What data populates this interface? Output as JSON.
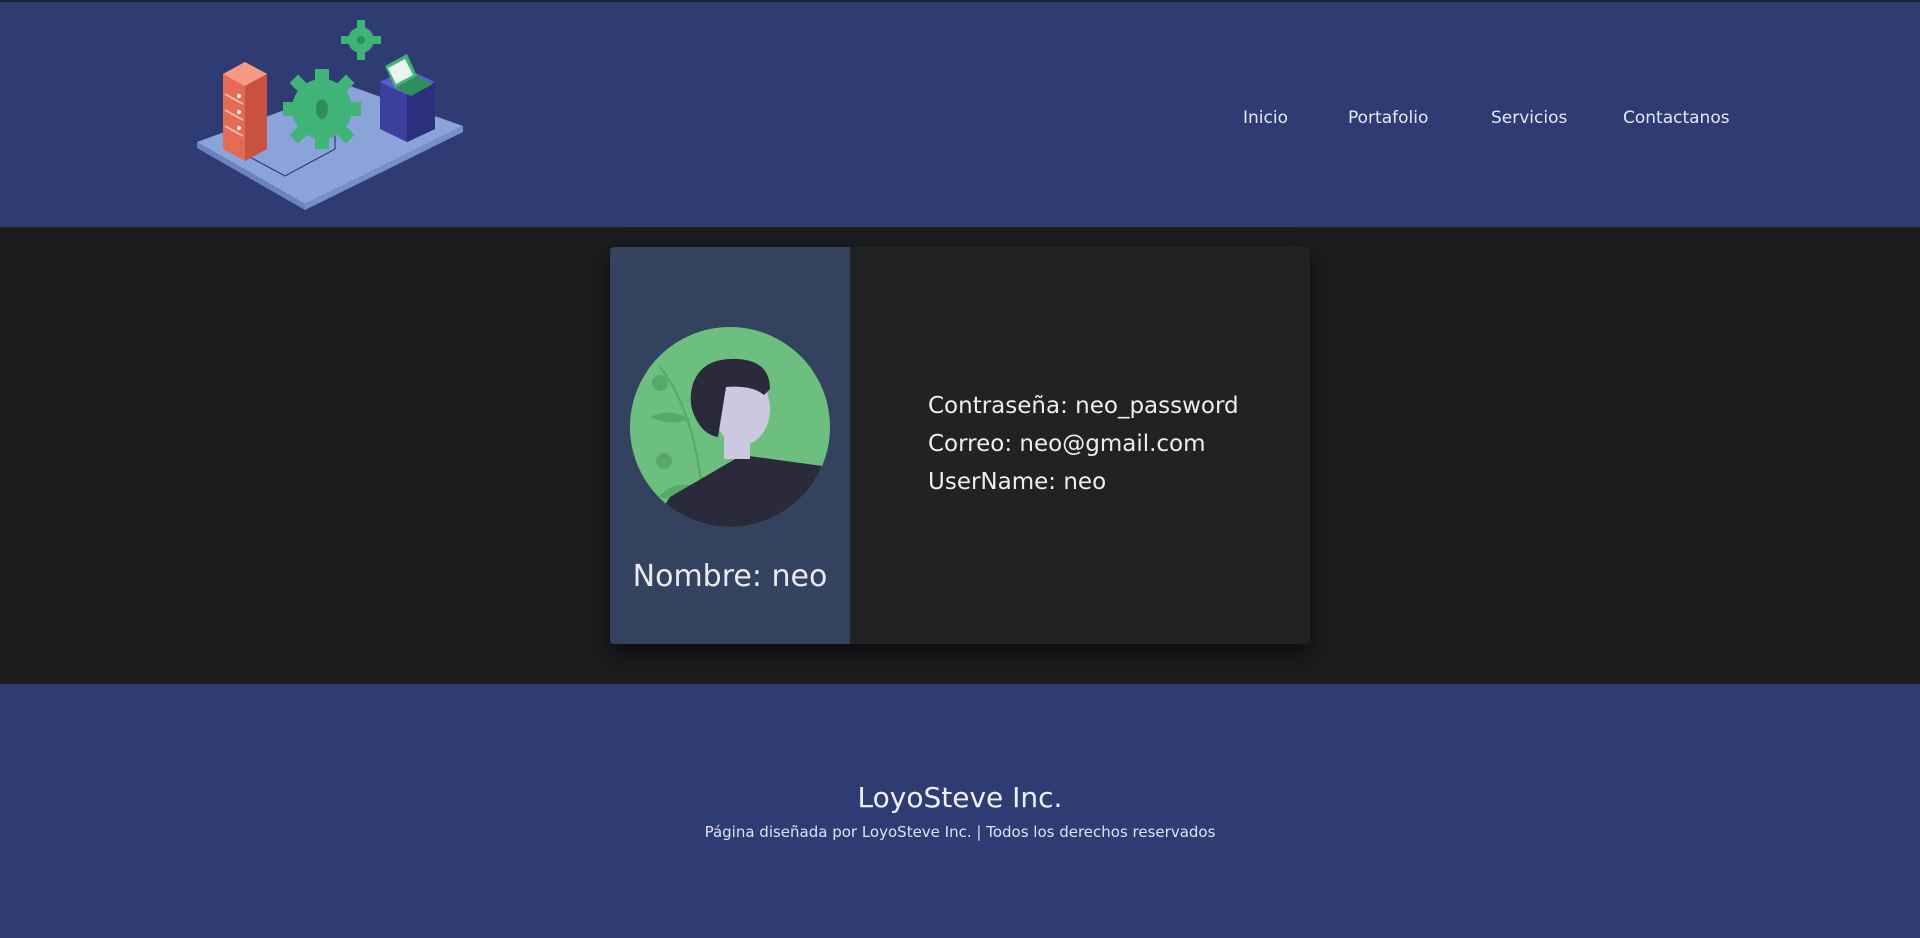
{
  "header": {
    "nav": [
      {
        "label": "Inicio"
      },
      {
        "label": "Portafolio"
      },
      {
        "label": "Servicios"
      },
      {
        "label": "Contactanos"
      }
    ]
  },
  "profile": {
    "name": "Nombre: neo",
    "password": "Contraseña: neo_password",
    "email": "Correo: neo@gmail.com",
    "username": "UserName: neo"
  },
  "footer": {
    "brand": "LoyoSteve Inc.",
    "credit": "Página diseñada por LoyoSteve Inc. | Todos los derechos reservados"
  },
  "icons": {
    "logo": "isometric-server-gears-illustration",
    "avatar": "user-avatar-icon"
  },
  "colors": {
    "header_bg": "#2f3b73",
    "body_bg": "#1b1c1e",
    "card_side_bg": "#33435f",
    "card_bg": "#212224",
    "avatar_green": "#6dbf7f"
  }
}
